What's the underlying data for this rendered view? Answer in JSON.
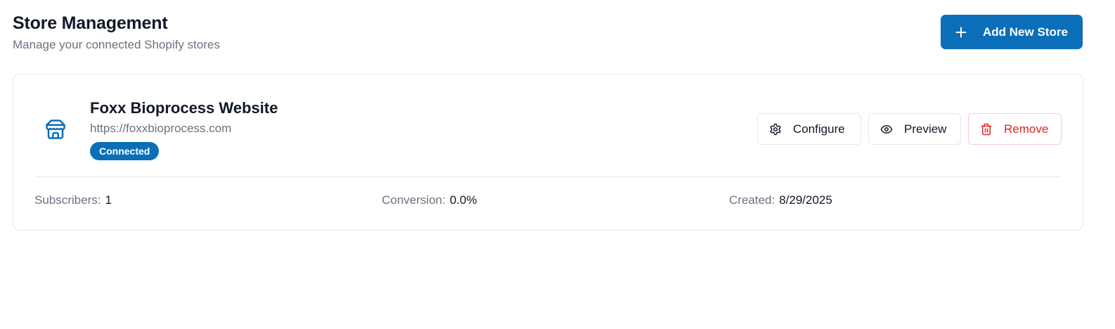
{
  "header": {
    "title": "Store Management",
    "subtitle": "Manage your connected Shopify stores",
    "add_button_label": "Add New Store"
  },
  "store": {
    "name": "Foxx Bioprocess Website",
    "url": "https://foxxbioprocess.com",
    "status": "Connected",
    "actions": {
      "configure": "Configure",
      "preview": "Preview",
      "remove": "Remove"
    },
    "stats": {
      "subscribers_label": "Subscribers:",
      "subscribers_value": "1",
      "conversion_label": "Conversion:",
      "conversion_value": "0.0%",
      "created_label": "Created:",
      "created_value": "8/29/2025"
    }
  },
  "icons": {
    "add": "plus-icon",
    "store": "store-icon",
    "configure": "gear-icon",
    "preview": "eye-icon",
    "remove": "trash-icon"
  },
  "colors": {
    "primary": "#0a6fb8",
    "danger": "#dc2626",
    "danger_border": "#fecaca",
    "muted_text": "#6b7280",
    "border": "#e5e7eb"
  }
}
